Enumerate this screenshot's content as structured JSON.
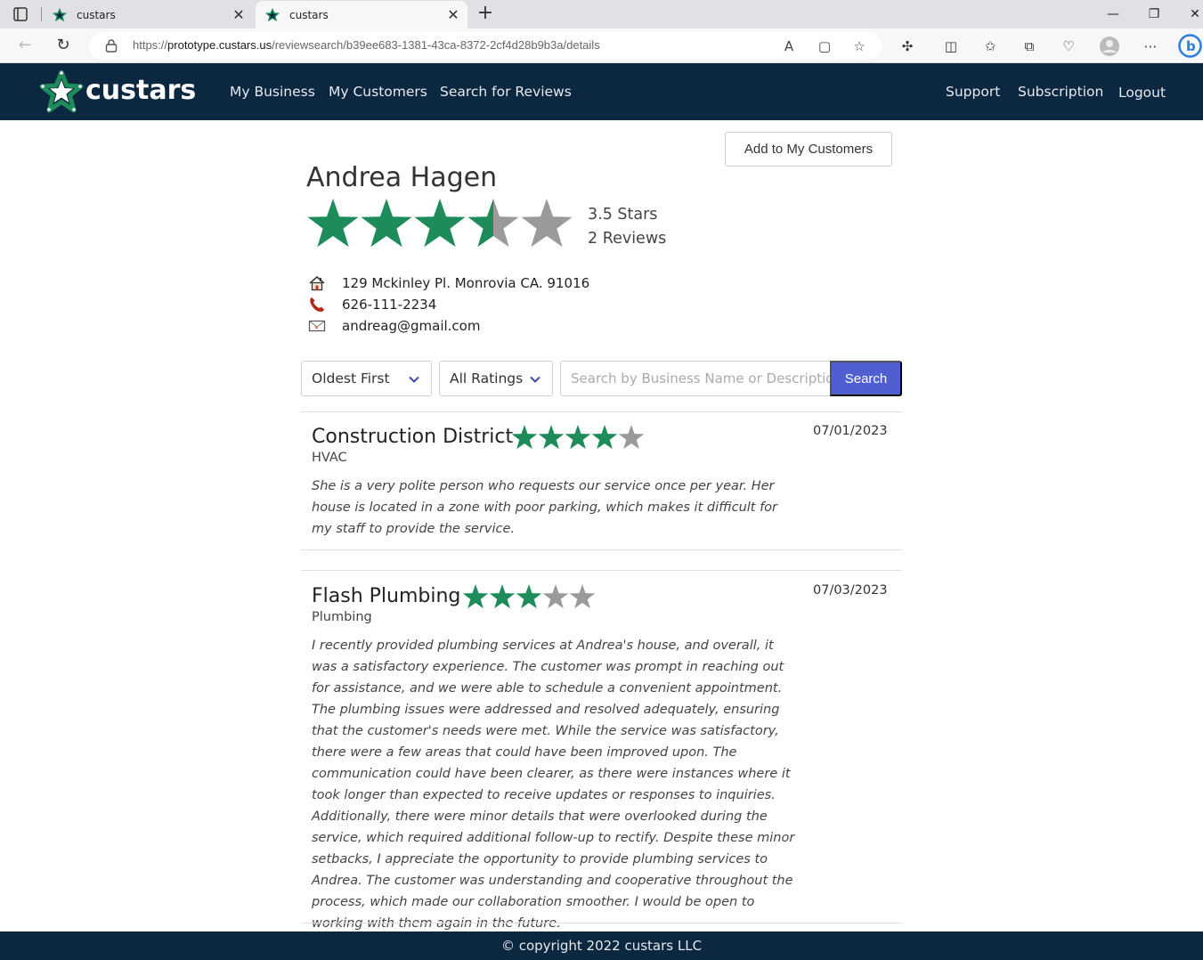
{
  "browser": {
    "tabs": [
      {
        "title": "custars",
        "active": false
      },
      {
        "title": "custars",
        "active": true
      }
    ],
    "url_scheme": "https://",
    "url_host": "prototype.custars.us",
    "url_path": "/reviewsearch/b39ee683-1381-43ca-8372-2cf4d28b9b3a/details"
  },
  "header": {
    "brand": "custars",
    "nav_left": [
      "My Business",
      "My Customers",
      "Search for Reviews"
    ],
    "nav_right": [
      "Support",
      "Subscription",
      "Logout"
    ]
  },
  "customer": {
    "add_button": "Add to My Customers",
    "name": "Andrea Hagen",
    "rating": 3.5,
    "stars_text": "3.5 Stars",
    "reviews_text": "2 Reviews",
    "address": "129 Mckinley Pl. Monrovia CA. 91016",
    "phone": "626-111-2234",
    "email": "andreag@gmail.com"
  },
  "filters": {
    "sort_selected": "Oldest First",
    "rating_selected": "All Ratings",
    "search_placeholder": "Search by Business Name or Description",
    "search_button": "Search"
  },
  "reviews": [
    {
      "business": "Construction District",
      "rating": 4,
      "category": "HVAC",
      "date": "07/01/2023",
      "text": "She is a very polite person who requests our service once per year. Her house is located in a zone with poor parking, which makes it difficult for my staff to provide the service."
    },
    {
      "business": "Flash Plumbing",
      "rating": 3,
      "category": "Plumbing",
      "date": "07/03/2023",
      "text": "I recently provided plumbing services at Andrea's house, and overall, it was a satisfactory experience. The customer was prompt in reaching out for assistance, and we were able to schedule a convenient appointment. The plumbing issues were addressed and resolved adequately, ensuring that the customer's needs were met. While the service was satisfactory, there were a few areas that could have been improved upon. The communication could have been clearer, as there were instances where it took longer than expected to receive updates or responses to inquiries. Additionally, there were minor details that were overlooked during the service, which required additional follow-up to rectify. Despite these minor setbacks, I appreciate the opportunity to provide plumbing services to Andrea. The customer was understanding and cooperative throughout the process, which made our collaboration smoother. I would be open to working with them again in the future."
    }
  ],
  "footer": {
    "text": "© copyright 2022 custars LLC"
  },
  "colors": {
    "star_filled": "#1e8c5a",
    "star_empty": "#9a9a9a",
    "header_bg": "#0c2740",
    "search_button": "#4f5fd0"
  }
}
